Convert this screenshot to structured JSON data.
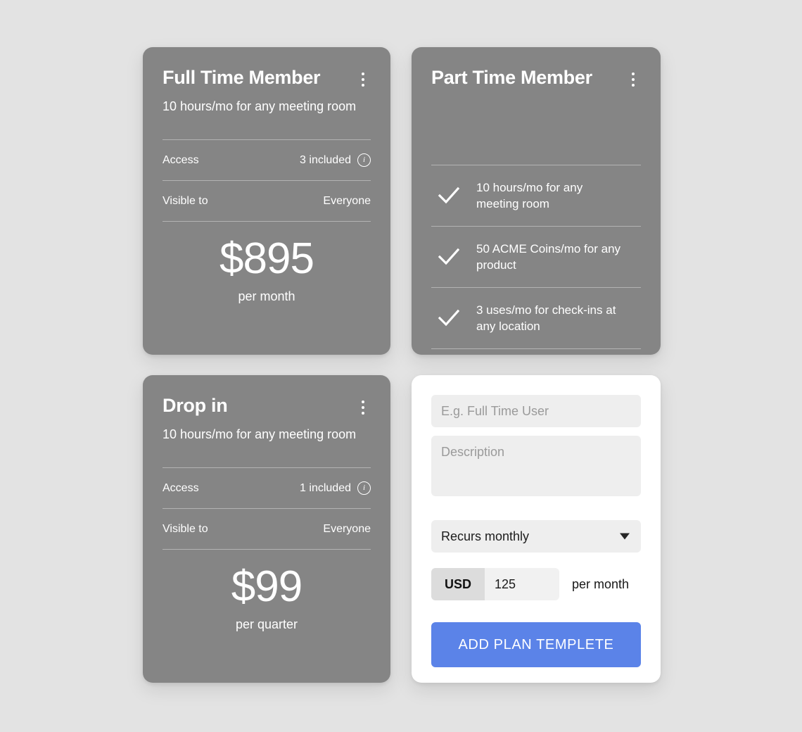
{
  "page": {
    "background_color": "#e3e3e3",
    "card_color": "#858585",
    "accent_color": "#5b83e8"
  },
  "cards": {
    "full_time": {
      "title": "Full Time Member",
      "subtitle": "10 hours/mo for any meeting room",
      "menu_icon": "kebab-menu-icon",
      "rows": [
        {
          "label": "Access",
          "value": "3 included",
          "info_icon": "info-icon"
        },
        {
          "label": "Visible to",
          "value": "Everyone"
        }
      ],
      "price": "$895",
      "period": "per month"
    },
    "part_time": {
      "title": "Part Time Member",
      "menu_icon": "kebab-menu-icon",
      "features": [
        {
          "check_icon": "check-icon",
          "text": "10 hours/mo for any meeting room"
        },
        {
          "check_icon": "check-icon",
          "text": "50 ACME Coins/mo for any product"
        },
        {
          "check_icon": "check-icon",
          "text": "3 uses/mo for check-ins at any location"
        }
      ]
    },
    "drop_in": {
      "title": "Drop in",
      "subtitle": "10 hours/mo for any meeting room",
      "menu_icon": "kebab-menu-icon",
      "rows": [
        {
          "label": "Access",
          "value": "1 included",
          "info_icon": "info-icon"
        },
        {
          "label": "Visible to",
          "value": "Everyone"
        }
      ],
      "price": "$99",
      "period": "per quarter"
    }
  },
  "form": {
    "name_placeholder": "E.g. Full Time User",
    "name_value": "",
    "description_placeholder": "Description",
    "description_value": "",
    "recurrence_selected": "Recurs monthly",
    "recurrence_caret_icon": "chevron-down-icon",
    "currency": "USD",
    "amount_value": "125",
    "amount_suffix": "per month",
    "submit_label": "ADD PLAN TEMPLETE"
  }
}
